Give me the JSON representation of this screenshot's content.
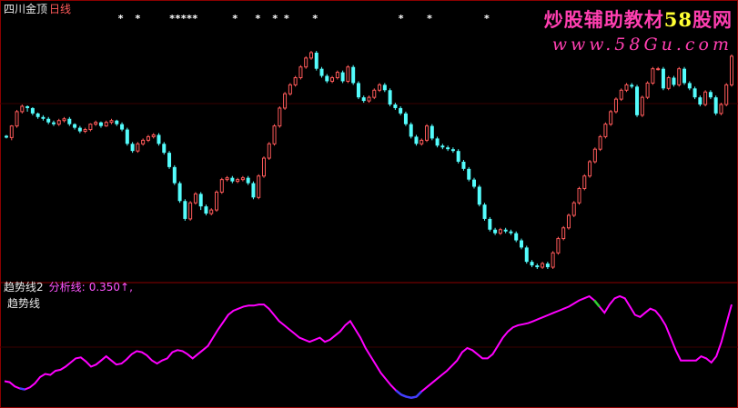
{
  "main_panel": {
    "stock_name": "四川金顶",
    "period": "日线"
  },
  "indicator_panel": {
    "indicator_label": "趋势线2",
    "analysis_label": "分析线:",
    "analysis_value": "0.350↑,",
    "line_name": "趋势线"
  },
  "watermark": {
    "line1_prefix": "炒股辅助教材",
    "line1_number": "58",
    "line1_suffix": "股网",
    "line2": "www.58Gu.com"
  },
  "colors": {
    "background": "#000000",
    "up_candle": "#ff5a5a",
    "down_candle": "#54fcfc",
    "trend_line": "#ff00ff",
    "trend_low": "#4040ff",
    "trend_high": "#30d030",
    "border": "#8b0000",
    "signal_marker": "#ffffff"
  },
  "chart_data": [
    {
      "type": "candlestick",
      "title": "",
      "series": [
        {
          "name": "",
          "bars": [
            [
              205,
              203,
              206,
              202
            ],
            [
              203,
              216,
              217,
              200
            ],
            [
              216,
              232,
              234,
              214
            ],
            [
              232,
              238,
              240,
              230
            ],
            [
              238,
              236,
              239,
              232
            ],
            [
              236,
              230,
              237,
              228
            ],
            [
              230,
              226,
              231,
              224
            ],
            [
              226,
              224,
              228,
              222
            ],
            [
              224,
              220,
              226,
              218
            ],
            [
              220,
              218,
              222,
              216
            ],
            [
              218,
              222,
              224,
              216
            ],
            [
              222,
              224,
              226,
              220
            ],
            [
              224,
              218,
              226,
              216
            ],
            [
              218,
              214,
              219,
              212
            ],
            [
              214,
              210,
              216,
              208
            ],
            [
              210,
              212,
              214,
              208
            ],
            [
              212,
              218,
              219,
              210
            ],
            [
              218,
              220,
              222,
              216
            ],
            [
              220,
              216,
              221,
              214
            ],
            [
              216,
              220,
              222,
              215
            ],
            [
              220,
              222,
              224,
              218
            ],
            [
              222,
              218,
              223,
              216
            ],
            [
              218,
              212,
              220,
              210
            ],
            [
              212,
              196,
              214,
              194
            ],
            [
              196,
              188,
              198,
              186
            ],
            [
              188,
              196,
              198,
              186
            ],
            [
              196,
              200,
              202,
              194
            ],
            [
              200,
              204,
              206,
              198
            ],
            [
              204,
              206,
              208,
              202
            ],
            [
              206,
              196,
              208,
              194
            ],
            [
              196,
              186,
              198,
              184
            ],
            [
              186,
              170,
              188,
              168
            ],
            [
              170,
              152,
              172,
              150
            ],
            [
              152,
              132,
              154,
              130
            ],
            [
              132,
              112,
              134,
              110
            ],
            [
              112,
              130,
              132,
              110
            ],
            [
              130,
              140,
              142,
              128
            ],
            [
              140,
              126,
              142,
              122
            ],
            [
              126,
              118,
              128,
              116
            ],
            [
              118,
              122,
              124,
              116
            ],
            [
              122,
              142,
              144,
              120
            ],
            [
              142,
              156,
              158,
              140
            ],
            [
              156,
              158,
              160,
              154
            ],
            [
              158,
              154,
              160,
              152
            ],
            [
              154,
              156,
              158,
              152
            ],
            [
              156,
              158,
              160,
              154
            ],
            [
              158,
              152,
              160,
              150
            ],
            [
              152,
              136,
              154,
              134
            ],
            [
              136,
              160,
              162,
              134
            ],
            [
              160,
              180,
              182,
              158
            ],
            [
              180,
              196,
              198,
              178
            ],
            [
              196,
              216,
              218,
              194
            ],
            [
              216,
              236,
              238,
              214
            ],
            [
              236,
              252,
              254,
              234
            ],
            [
              252,
              262,
              264,
              250
            ],
            [
              262,
              270,
              272,
              260
            ],
            [
              270,
              282,
              284,
              268
            ],
            [
              282,
              292,
              294,
              280
            ],
            [
              292,
              298,
              300,
              290
            ],
            [
              298,
              280,
              300,
              278
            ],
            [
              280,
              272,
              282,
              270
            ],
            [
              272,
              266,
              274,
              264
            ],
            [
              266,
              270,
              272,
              264
            ],
            [
              270,
              276,
              278,
              268
            ],
            [
              276,
              266,
              278,
              264
            ],
            [
              266,
              282,
              284,
              264
            ],
            [
              282,
              264,
              284,
              262
            ],
            [
              264,
              248,
              266,
              246
            ],
            [
              248,
              244,
              250,
              242
            ],
            [
              244,
              248,
              250,
              242
            ],
            [
              248,
              256,
              258,
              246
            ],
            [
              256,
              262,
              264,
              254
            ],
            [
              262,
              256,
              264,
              254
            ],
            [
              256,
              240,
              258,
              238
            ],
            [
              240,
              236,
              242,
              234
            ],
            [
              236,
              230,
              238,
              228
            ],
            [
              230,
              218,
              232,
              216
            ],
            [
              218,
              204,
              220,
              202
            ],
            [
              204,
              196,
              206,
              194
            ],
            [
              196,
              200,
              202,
              194
            ],
            [
              200,
              216,
              218,
              198
            ],
            [
              216,
              202,
              218,
              200
            ],
            [
              202,
              194,
              204,
              192
            ],
            [
              194,
              192,
              196,
              190
            ],
            [
              192,
              190,
              194,
              188
            ],
            [
              190,
              188,
              192,
              186
            ],
            [
              188,
              176,
              190,
              174
            ],
            [
              176,
              168,
              178,
              166
            ],
            [
              168,
              156,
              170,
              154
            ],
            [
              156,
              148,
              158,
              146
            ],
            [
              148,
              128,
              150,
              126
            ],
            [
              128,
              112,
              130,
              110
            ],
            [
              112,
              100,
              114,
              98
            ],
            [
              100,
              96,
              102,
              94
            ],
            [
              96,
              100,
              102,
              94
            ],
            [
              100,
              98,
              102,
              96
            ],
            [
              98,
              96,
              100,
              94
            ],
            [
              96,
              88,
              98,
              86
            ],
            [
              88,
              80,
              90,
              78
            ],
            [
              80,
              64,
              82,
              62
            ],
            [
              64,
              60,
              66,
              58
            ],
            [
              60,
              58,
              62,
              56
            ],
            [
              58,
              62,
              64,
              56
            ],
            [
              62,
              58,
              64,
              56
            ],
            [
              58,
              74,
              76,
              56
            ],
            [
              74,
              90,
              92,
              72
            ],
            [
              90,
              102,
              104,
              88
            ],
            [
              102,
              116,
              118,
              100
            ],
            [
              116,
              130,
              132,
              114
            ],
            [
              130,
              146,
              148,
              128
            ],
            [
              146,
              160,
              162,
              144
            ],
            [
              160,
              176,
              178,
              158
            ],
            [
              176,
              190,
              192,
              174
            ],
            [
              190,
              204,
              206,
              188
            ],
            [
              204,
              218,
              220,
              202
            ],
            [
              218,
              232,
              234,
              216
            ],
            [
              232,
              246,
              248,
              230
            ],
            [
              246,
              256,
              258,
              244
            ],
            [
              256,
              262,
              264,
              254
            ],
            [
              262,
              260,
              264,
              258
            ],
            [
              260,
              228,
              262,
              226
            ],
            [
              228,
              248,
              250,
              226
            ],
            [
              248,
              264,
              266,
              246
            ],
            [
              264,
              280,
              282,
              262
            ],
            [
              280,
              280,
              282,
              278
            ],
            [
              280,
              258,
              282,
              256
            ],
            [
              258,
              270,
              272,
              256
            ],
            [
              270,
              262,
              272,
              260
            ],
            [
              262,
              280,
              282,
              260
            ],
            [
              280,
              264,
              282,
              262
            ],
            [
              264,
              258,
              266,
              256
            ],
            [
              258,
              248,
              260,
              246
            ],
            [
              248,
              240,
              250,
              238
            ],
            [
              240,
              254,
              256,
              238
            ],
            [
              254,
              248,
              256,
              246
            ],
            [
              248,
              230,
              250,
              228
            ],
            [
              230,
              240,
              242,
              228
            ],
            [
              240,
              262,
              264,
              238
            ],
            [
              262,
              294,
              296,
              260
            ]
          ]
        }
      ],
      "signals": [
        2,
        5,
        11,
        12,
        13,
        14,
        15,
        22,
        26,
        29,
        31,
        36,
        51,
        56,
        66
      ]
    },
    {
      "type": "line",
      "title": "",
      "series": [
        {
          "name": "趋势线",
          "values": [
            0.18,
            0.17,
            0.13,
            0.11,
            0.1,
            0.12,
            0.16,
            0.22,
            0.25,
            0.24,
            0.28,
            0.29,
            0.32,
            0.36,
            0.4,
            0.41,
            0.37,
            0.32,
            0.34,
            0.38,
            0.42,
            0.38,
            0.34,
            0.35,
            0.39,
            0.44,
            0.47,
            0.46,
            0.43,
            0.38,
            0.35,
            0.38,
            0.4,
            0.46,
            0.48,
            0.47,
            0.44,
            0.4,
            0.44,
            0.48,
            0.52,
            0.6,
            0.68,
            0.75,
            0.82,
            0.86,
            0.88,
            0.9,
            0.91,
            0.91,
            0.92,
            0.92,
            0.88,
            0.82,
            0.76,
            0.72,
            0.68,
            0.64,
            0.6,
            0.58,
            0.56,
            0.58,
            0.6,
            0.56,
            0.58,
            0.62,
            0.66,
            0.72,
            0.76,
            0.68,
            0.6,
            0.5,
            0.42,
            0.34,
            0.26,
            0.2,
            0.14,
            0.09,
            0.05,
            0.03,
            0.02,
            0.03,
            0.08,
            0.12,
            0.16,
            0.2,
            0.24,
            0.28,
            0.33,
            0.38,
            0.46,
            0.5,
            0.48,
            0.44,
            0.4,
            0.4,
            0.44,
            0.52,
            0.6,
            0.66,
            0.7,
            0.72,
            0.73,
            0.74,
            0.76,
            0.78,
            0.8,
            0.82,
            0.84,
            0.86,
            0.88,
            0.9,
            0.93,
            0.96,
            0.98,
            1.0,
            0.96,
            0.9,
            0.84,
            0.92,
            0.98,
            1.0,
            0.98,
            0.9,
            0.82,
            0.8,
            0.84,
            0.88,
            0.86,
            0.8,
            0.72,
            0.6,
            0.48,
            0.38,
            0.38,
            0.38,
            0.38,
            0.42,
            0.4,
            0.36,
            0.42,
            0.56,
            0.74,
            0.92
          ]
        }
      ],
      "ylim": [
        0,
        1
      ]
    }
  ]
}
